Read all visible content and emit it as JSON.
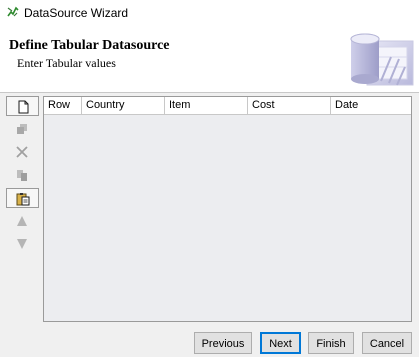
{
  "window": {
    "title": "DataSource Wizard"
  },
  "header": {
    "title": "Define Tabular Datasource",
    "subtitle": "Enter Tabular values"
  },
  "toolbar": {
    "items": [
      {
        "icon": "new-row-icon",
        "enabled": true
      },
      {
        "icon": "duplicate-icon",
        "enabled": false
      },
      {
        "icon": "delete-icon",
        "enabled": false
      },
      {
        "icon": "copy-icon",
        "enabled": false
      },
      {
        "icon": "paste-icon",
        "enabled": true
      },
      {
        "icon": "move-up-icon",
        "enabled": false
      },
      {
        "icon": "move-down-icon",
        "enabled": false
      }
    ]
  },
  "table": {
    "columns": [
      "Row",
      "Country",
      "Item",
      "Cost",
      "Date"
    ],
    "rows": []
  },
  "buttons": {
    "previous": "Previous",
    "next": "Next",
    "finish": "Finish",
    "cancel": "Cancel"
  }
}
